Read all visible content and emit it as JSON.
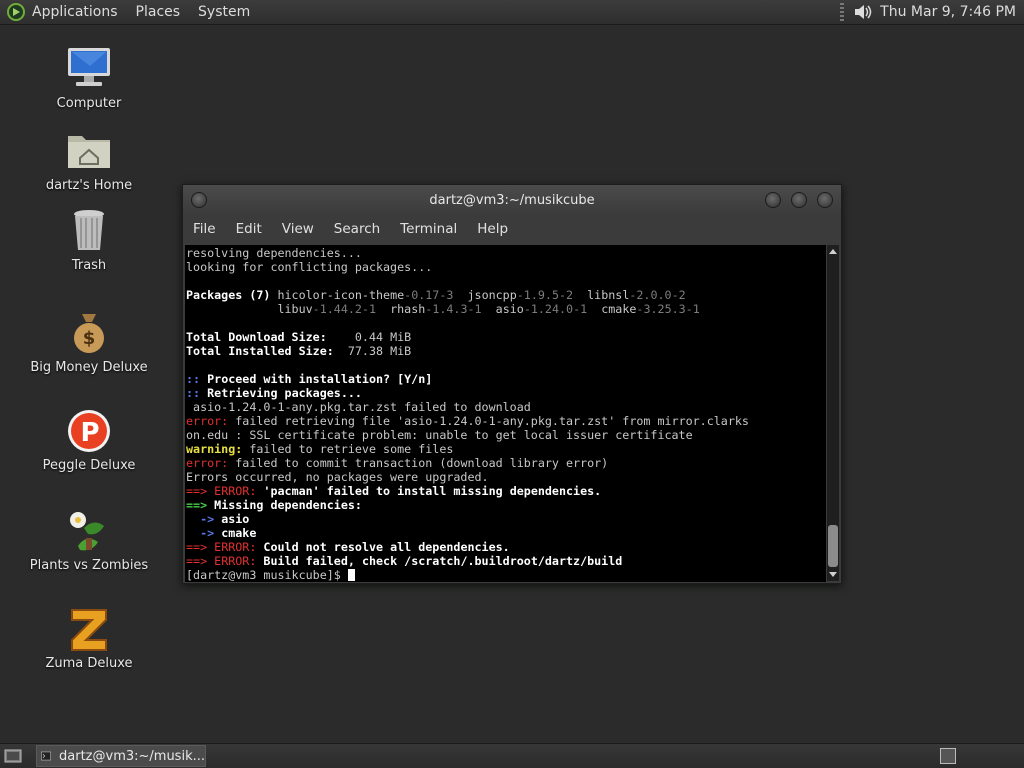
{
  "top_panel": {
    "menus": [
      "Applications",
      "Places",
      "System"
    ],
    "clock": "Thu Mar  9,  7:46 PM"
  },
  "desktop_icons": [
    {
      "label": "Computer",
      "icon": "computer-icon"
    },
    {
      "label": "dartz's Home",
      "icon": "home-folder-icon"
    },
    {
      "label": "Trash",
      "icon": "trash-icon"
    },
    {
      "label": "Big Money Deluxe",
      "icon": "money-bag-icon"
    },
    {
      "label": "Peggle Deluxe",
      "icon": "peggle-icon"
    },
    {
      "label": "Plants vs Zombies",
      "icon": "plants-icon"
    },
    {
      "label": "Zuma Deluxe",
      "icon": "zuma-icon"
    }
  ],
  "terminal": {
    "title": "dartz@vm3:~/musikcube",
    "menus": [
      "File",
      "Edit",
      "View",
      "Search",
      "Terminal",
      "Help"
    ],
    "lines": [
      [
        {
          "t": "resolving dependencies...",
          "c": ""
        }
      ],
      [
        {
          "t": "looking for conflicting packages...",
          "c": ""
        }
      ],
      [
        {
          "t": "",
          "c": ""
        }
      ],
      [
        {
          "t": "Packages (7) ",
          "c": "b"
        },
        {
          "t": "hicolor-icon-theme",
          "c": ""
        },
        {
          "t": "-0.17-3",
          "c": "dim"
        },
        {
          "t": "  jsoncpp",
          "c": ""
        },
        {
          "t": "-1.9.5-2",
          "c": "dim"
        },
        {
          "t": "  libnsl",
          "c": ""
        },
        {
          "t": "-2.0.0-2",
          "c": "dim"
        }
      ],
      [
        {
          "t": "             libuv",
          "c": ""
        },
        {
          "t": "-1.44.2-1",
          "c": "dim"
        },
        {
          "t": "  rhash",
          "c": ""
        },
        {
          "t": "-1.4.3-1",
          "c": "dim"
        },
        {
          "t": "  asio",
          "c": ""
        },
        {
          "t": "-1.24.0-1",
          "c": "dim"
        },
        {
          "t": "  cmake",
          "c": ""
        },
        {
          "t": "-3.25.3-1",
          "c": "dim"
        }
      ],
      [
        {
          "t": "",
          "c": ""
        }
      ],
      [
        {
          "t": "Total Download Size:    ",
          "c": "b"
        },
        {
          "t": "0.44 MiB",
          "c": ""
        }
      ],
      [
        {
          "t": "Total Installed Size:  ",
          "c": "b"
        },
        {
          "t": "77.38 MiB",
          "c": ""
        }
      ],
      [
        {
          "t": "",
          "c": ""
        }
      ],
      [
        {
          "t": ":: ",
          "c": "blu"
        },
        {
          "t": "Proceed with installation? [Y/n]",
          "c": "b"
        }
      ],
      [
        {
          "t": ":: ",
          "c": "blu"
        },
        {
          "t": "Retrieving packages...",
          "c": "b"
        }
      ],
      [
        {
          "t": " asio-1.24.0-1-any.pkg.tar.zst failed to download",
          "c": ""
        }
      ],
      [
        {
          "t": "error:",
          "c": "red"
        },
        {
          "t": " failed retrieving file 'asio-1.24.0-1-any.pkg.tar.zst' from mirror.clarks",
          "c": ""
        }
      ],
      [
        {
          "t": "on.edu : SSL certificate problem: unable to get local issuer certificate",
          "c": ""
        }
      ],
      [
        {
          "t": "warning:",
          "c": "yel"
        },
        {
          "t": " failed to retrieve some files",
          "c": ""
        }
      ],
      [
        {
          "t": "error:",
          "c": "red"
        },
        {
          "t": " failed to commit transaction (download library error)",
          "c": ""
        }
      ],
      [
        {
          "t": "Errors occurred, no packages were upgraded.",
          "c": ""
        }
      ],
      [
        {
          "t": "==> ",
          "c": "red"
        },
        {
          "t": "ERROR:",
          "c": "red"
        },
        {
          "t": " 'pacman' failed to install missing dependencies.",
          "c": "b"
        }
      ],
      [
        {
          "t": "==> ",
          "c": "grn"
        },
        {
          "t": "Missing dependencies:",
          "c": "b"
        }
      ],
      [
        {
          "t": "  -> ",
          "c": "blu"
        },
        {
          "t": "asio",
          "c": "b"
        }
      ],
      [
        {
          "t": "  -> ",
          "c": "blu"
        },
        {
          "t": "cmake",
          "c": "b"
        }
      ],
      [
        {
          "t": "==> ",
          "c": "red"
        },
        {
          "t": "ERROR:",
          "c": "red"
        },
        {
          "t": " Could not resolve all dependencies.",
          "c": "b"
        }
      ],
      [
        {
          "t": "==> ",
          "c": "red"
        },
        {
          "t": "ERROR:",
          "c": "red"
        },
        {
          "t": " Build failed, check /scratch/.buildroot/dartz/build",
          "c": "b"
        }
      ],
      [
        {
          "t": "[dartz@vm3 musikcube]$ ",
          "c": ""
        }
      ]
    ]
  },
  "bottom_panel": {
    "task_label": "dartz@vm3:~/musik..."
  }
}
